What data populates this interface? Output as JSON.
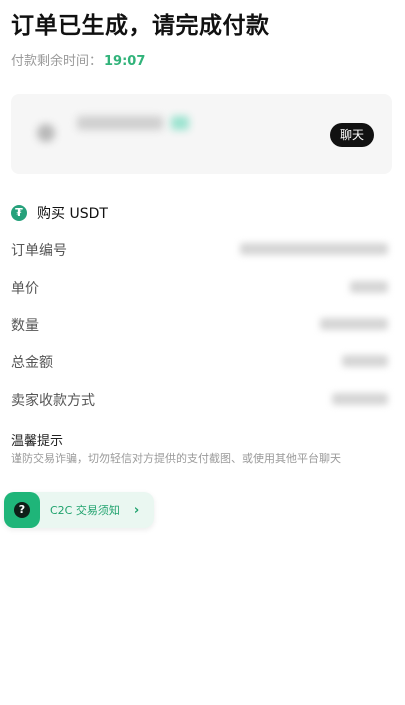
{
  "header": {
    "title": "订单已生成，请完成付款",
    "timer_label": "付款剩余时间：",
    "timer_value": "19:07"
  },
  "seller": {
    "chat_label": "聊天"
  },
  "order": {
    "buy_label": "购买 USDT",
    "usdt_icon_glyph": "₮",
    "rows": [
      {
        "label": "订单编号"
      },
      {
        "label": "单价"
      },
      {
        "label": "数量"
      },
      {
        "label": "总金额"
      },
      {
        "label": "卖家收款方式"
      }
    ]
  },
  "tips": {
    "title": "温馨提示",
    "text": "谨防交易诈骗，切勿轻信对方提供的支付截图、或使用其他平台聊天"
  },
  "c2c": {
    "icon_glyph": "?",
    "label": "C2C 交易须知",
    "chevron": "›"
  },
  "colors": {
    "accent_green": "#31b37a",
    "usdt_green": "#26a17b",
    "c2c_green": "#1fb579"
  }
}
